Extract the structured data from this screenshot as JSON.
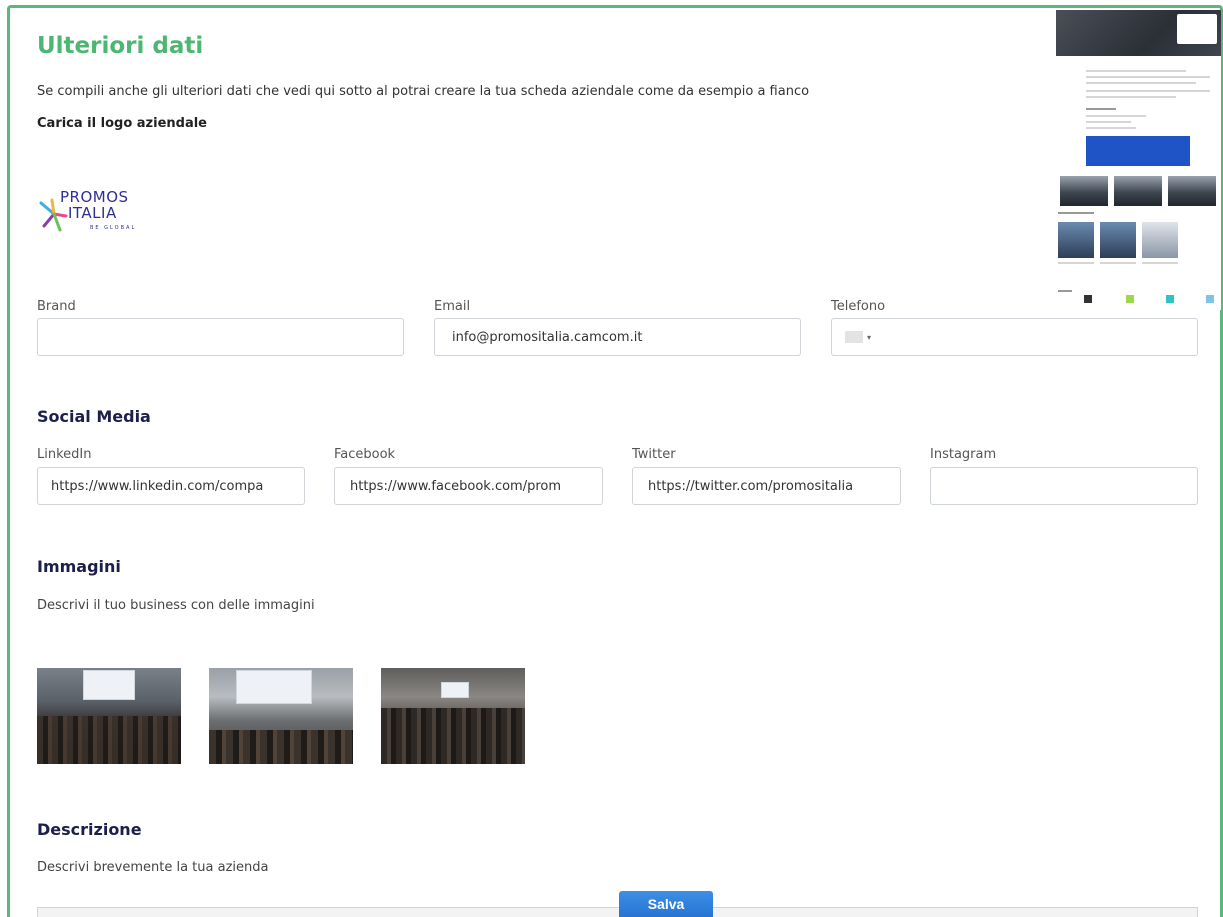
{
  "header": {
    "title": "Ulteriori dati",
    "intro": "Se compili anche gli ulteriori dati che vedi qui sotto al potrai creare la tua scheda aziendale come da esempio a fianco",
    "logo_label": "Carica il logo aziendale"
  },
  "logo": {
    "line1": "PROMOS",
    "line2": "ITALIA",
    "tagline": "BE GLOBAL"
  },
  "contact": {
    "brand_label": "Brand",
    "brand_value": "",
    "email_label": "Email",
    "email_value": "info@promositalia.camcom.it",
    "phone_label": "Telefono",
    "phone_arrow": "▾"
  },
  "social": {
    "title": "Social Media",
    "linkedin_label": "LinkedIn",
    "linkedin_value": "https://www.linkedin.com/compa",
    "facebook_label": "Facebook",
    "facebook_value": "https://www.facebook.com/prom",
    "twitter_label": "Twitter",
    "twitter_value": "https://twitter.com/promositalia",
    "instagram_label": "Instagram",
    "instagram_value": ""
  },
  "images": {
    "title": "Immagini",
    "subtitle": "Descrivi il tuo business con delle immagini"
  },
  "description": {
    "title": "Descrizione",
    "subtitle": "Descrivi brevemente la tua azienda"
  },
  "actions": {
    "save": "Salva"
  },
  "colors": {
    "accent_green": "#4cb672",
    "section_navy": "#1d1f4b",
    "button_blue": "#2774d3"
  }
}
